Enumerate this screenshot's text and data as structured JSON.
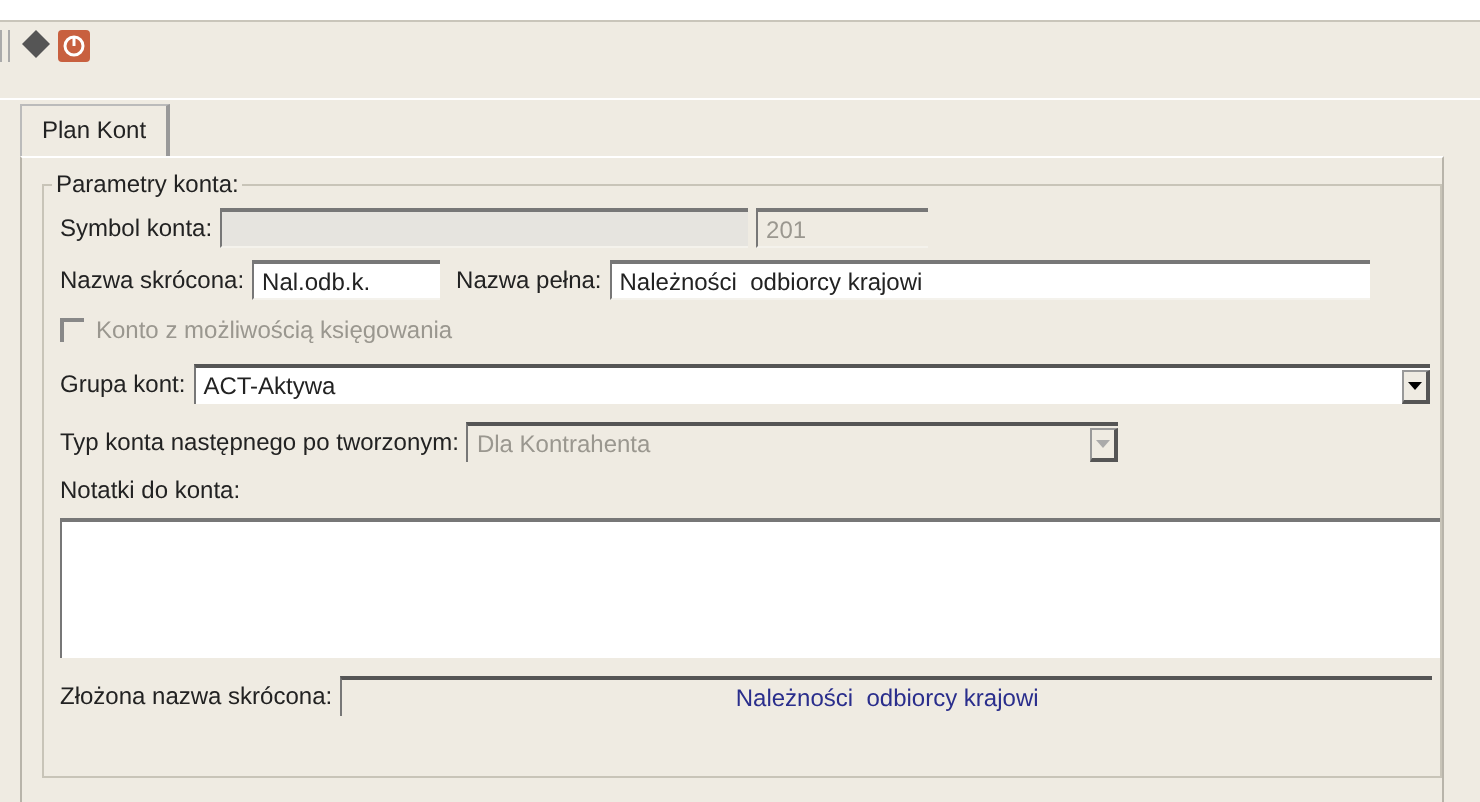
{
  "tabs": [
    {
      "label": "Plan Kont",
      "selected": true
    }
  ],
  "group": {
    "legend": "Parametry konta:"
  },
  "symbol": {
    "label": "Symbol konta:",
    "code": "201"
  },
  "short_name": {
    "label": "Nazwa skrócona:",
    "value": "Nal.odb.k."
  },
  "full_name": {
    "label": "Nazwa pełna:",
    "value": "Należności  odbiorcy krajowi"
  },
  "posting": {
    "label": "Konto z możliwością księgowania",
    "checked": false,
    "disabled": true
  },
  "account_group": {
    "label": "Grupa kont:",
    "value": "ACT-Aktywa",
    "disabled": false
  },
  "next_type": {
    "label": "Typ konta następnego po tworzonym:",
    "value": "Dla Kontrahenta",
    "disabled": true
  },
  "notes": {
    "label": "Notatki do konta:"
  },
  "composite": {
    "label": "Złożona nazwa skrócona:",
    "value": "Należności  odbiorcy krajowi"
  }
}
